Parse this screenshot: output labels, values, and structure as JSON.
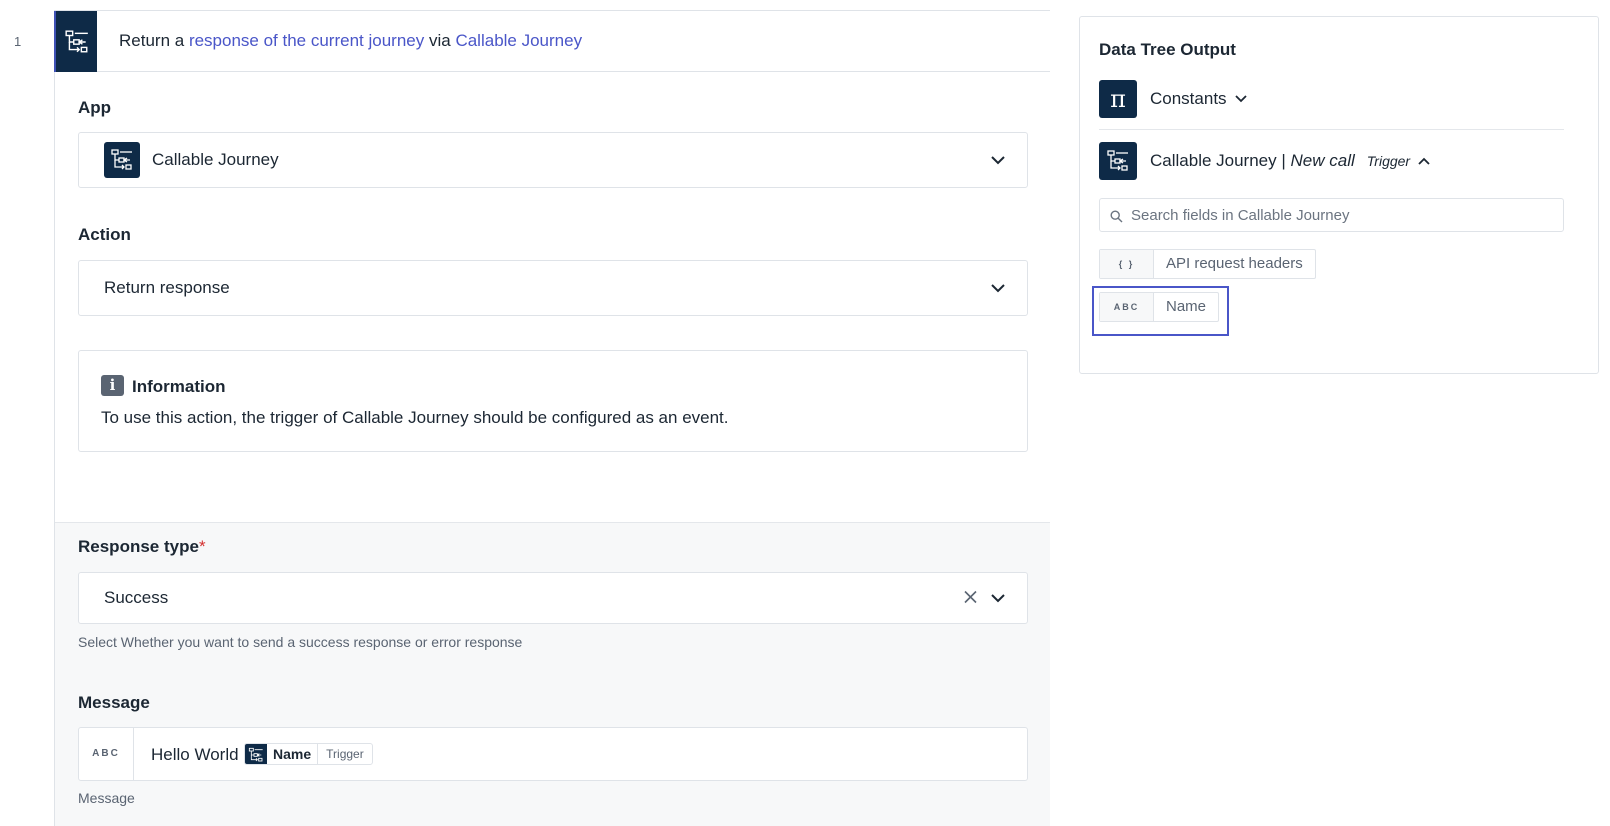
{
  "step": {
    "number": "1",
    "title_prefix": "Return a",
    "title_link_1": "response of the current journey",
    "title_mid": "via",
    "title_link_2": "Callable Journey"
  },
  "app_section": {
    "label": "App",
    "selected_app": "Callable Journey"
  },
  "action_section": {
    "label": "Action",
    "selected_action": "Return response"
  },
  "information": {
    "icon_glyph": "i",
    "title": "Information",
    "text": "To use this action, the trigger of Callable Journey should be configured as an event."
  },
  "response_type": {
    "label": "Response type",
    "required_mark": "*",
    "value": "Success",
    "help": "Select Whether you want to send a success response or error response"
  },
  "message": {
    "label": "Message",
    "type_badge": "ABC",
    "text": "Hello World",
    "pill_name": "Name",
    "pill_source": "Trigger",
    "help": "Message"
  },
  "data_tree": {
    "title": "Data Tree Output",
    "constants_label": "Constants",
    "constants_glyph": "π",
    "source_app": "Callable Journey",
    "source_separator": "|",
    "source_event": "New call",
    "source_kind": "Trigger",
    "search_placeholder": "Search fields in Callable Journey",
    "fields": [
      {
        "type": "{ }",
        "name": "API request headers"
      },
      {
        "type": "ABC",
        "name": "Name"
      }
    ]
  },
  "colors": {
    "app_tile": "#0e2a47",
    "link": "#4a56c8",
    "highlight": "#4a56c8",
    "required": "#d32f2f"
  },
  "icons": [
    "callable-journey-icon",
    "chevron-down-icon",
    "chevron-up-icon",
    "clear-icon",
    "info-icon",
    "search-icon",
    "pi-icon"
  ]
}
